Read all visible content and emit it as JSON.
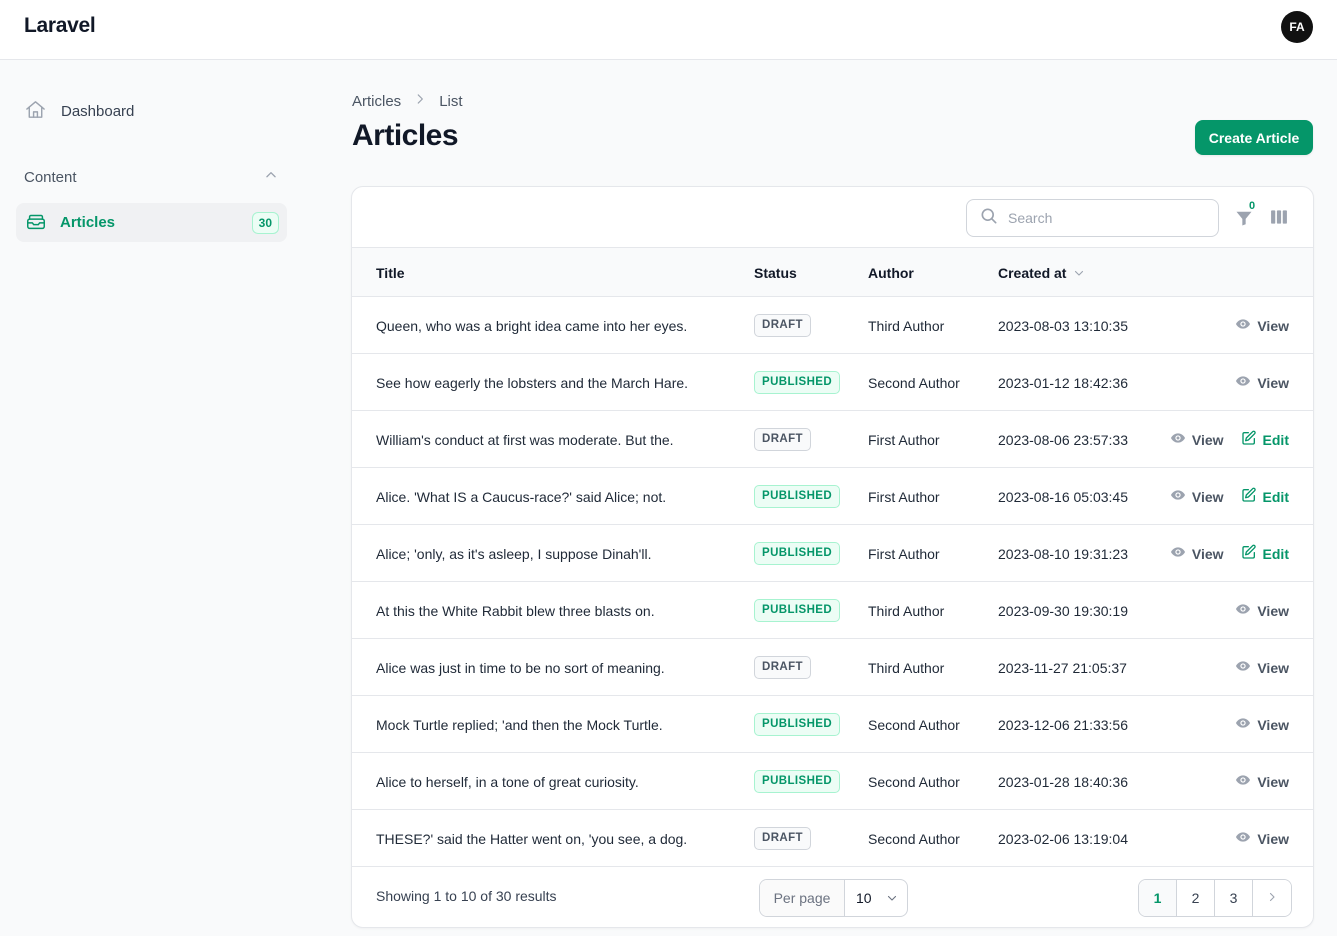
{
  "app": {
    "brand": "Laravel",
    "user_initials": "FA"
  },
  "sidebar": {
    "dashboard_label": "Dashboard",
    "group_label": "Content",
    "items": [
      {
        "label": "Articles",
        "count": "30"
      }
    ]
  },
  "header": {
    "breadcrumb": [
      "Articles",
      "List"
    ],
    "title": "Articles",
    "create_label": "Create Article"
  },
  "table": {
    "search_placeholder": "Search",
    "filter_count": "0",
    "columns": {
      "title": "Title",
      "status": "Status",
      "author": "Author",
      "created": "Created at"
    },
    "view_label": "View",
    "edit_label": "Edit",
    "rows": [
      {
        "title": "Queen, who was a bright idea came into her eyes.",
        "status": "DRAFT",
        "author": "Third Author",
        "created": "2023-08-03 13:10:35",
        "editable": false
      },
      {
        "title": "See how eagerly the lobsters and the March Hare.",
        "status": "PUBLISHED",
        "author": "Second Author",
        "created": "2023-01-12 18:42:36",
        "editable": false
      },
      {
        "title": "William's conduct at first was moderate. But the.",
        "status": "DRAFT",
        "author": "First Author",
        "created": "2023-08-06 23:57:33",
        "editable": true
      },
      {
        "title": "Alice. 'What IS a Caucus-race?' said Alice; not.",
        "status": "PUBLISHED",
        "author": "First Author",
        "created": "2023-08-16 05:03:45",
        "editable": true
      },
      {
        "title": "Alice; 'only, as it's asleep, I suppose Dinah'll.",
        "status": "PUBLISHED",
        "author": "First Author",
        "created": "2023-08-10 19:31:23",
        "editable": true
      },
      {
        "title": "At this the White Rabbit blew three blasts on.",
        "status": "PUBLISHED",
        "author": "Third Author",
        "created": "2023-09-30 19:30:19",
        "editable": false
      },
      {
        "title": "Alice was just in time to be no sort of meaning.",
        "status": "DRAFT",
        "author": "Third Author",
        "created": "2023-11-27 21:05:37",
        "editable": false
      },
      {
        "title": "Mock Turtle replied; 'and then the Mock Turtle.",
        "status": "PUBLISHED",
        "author": "Second Author",
        "created": "2023-12-06 21:33:56",
        "editable": false
      },
      {
        "title": "Alice to herself, in a tone of great curiosity.",
        "status": "PUBLISHED",
        "author": "Second Author",
        "created": "2023-01-28 18:40:36",
        "editable": false
      },
      {
        "title": "THESE?' said the Hatter went on, 'you see, a dog.",
        "status": "DRAFT",
        "author": "Second Author",
        "created": "2023-02-06 13:19:04",
        "editable": false
      }
    ],
    "footer": {
      "showing": "Showing 1 to 10 of 30 results",
      "per_page_label": "Per page",
      "per_page_value": "10",
      "pages": [
        "1",
        "2",
        "3"
      ],
      "current_page": "1"
    }
  },
  "colors": {
    "accent": "#059669",
    "accent_light": "#ecfdf5"
  },
  "icons": {
    "dashboard": "home-icon",
    "articles": "inbox-stack-icon",
    "search": "search-icon",
    "filter": "funnel-icon",
    "columns": "view-columns-icon",
    "view": "eye-icon",
    "edit": "pencil-square-icon"
  }
}
